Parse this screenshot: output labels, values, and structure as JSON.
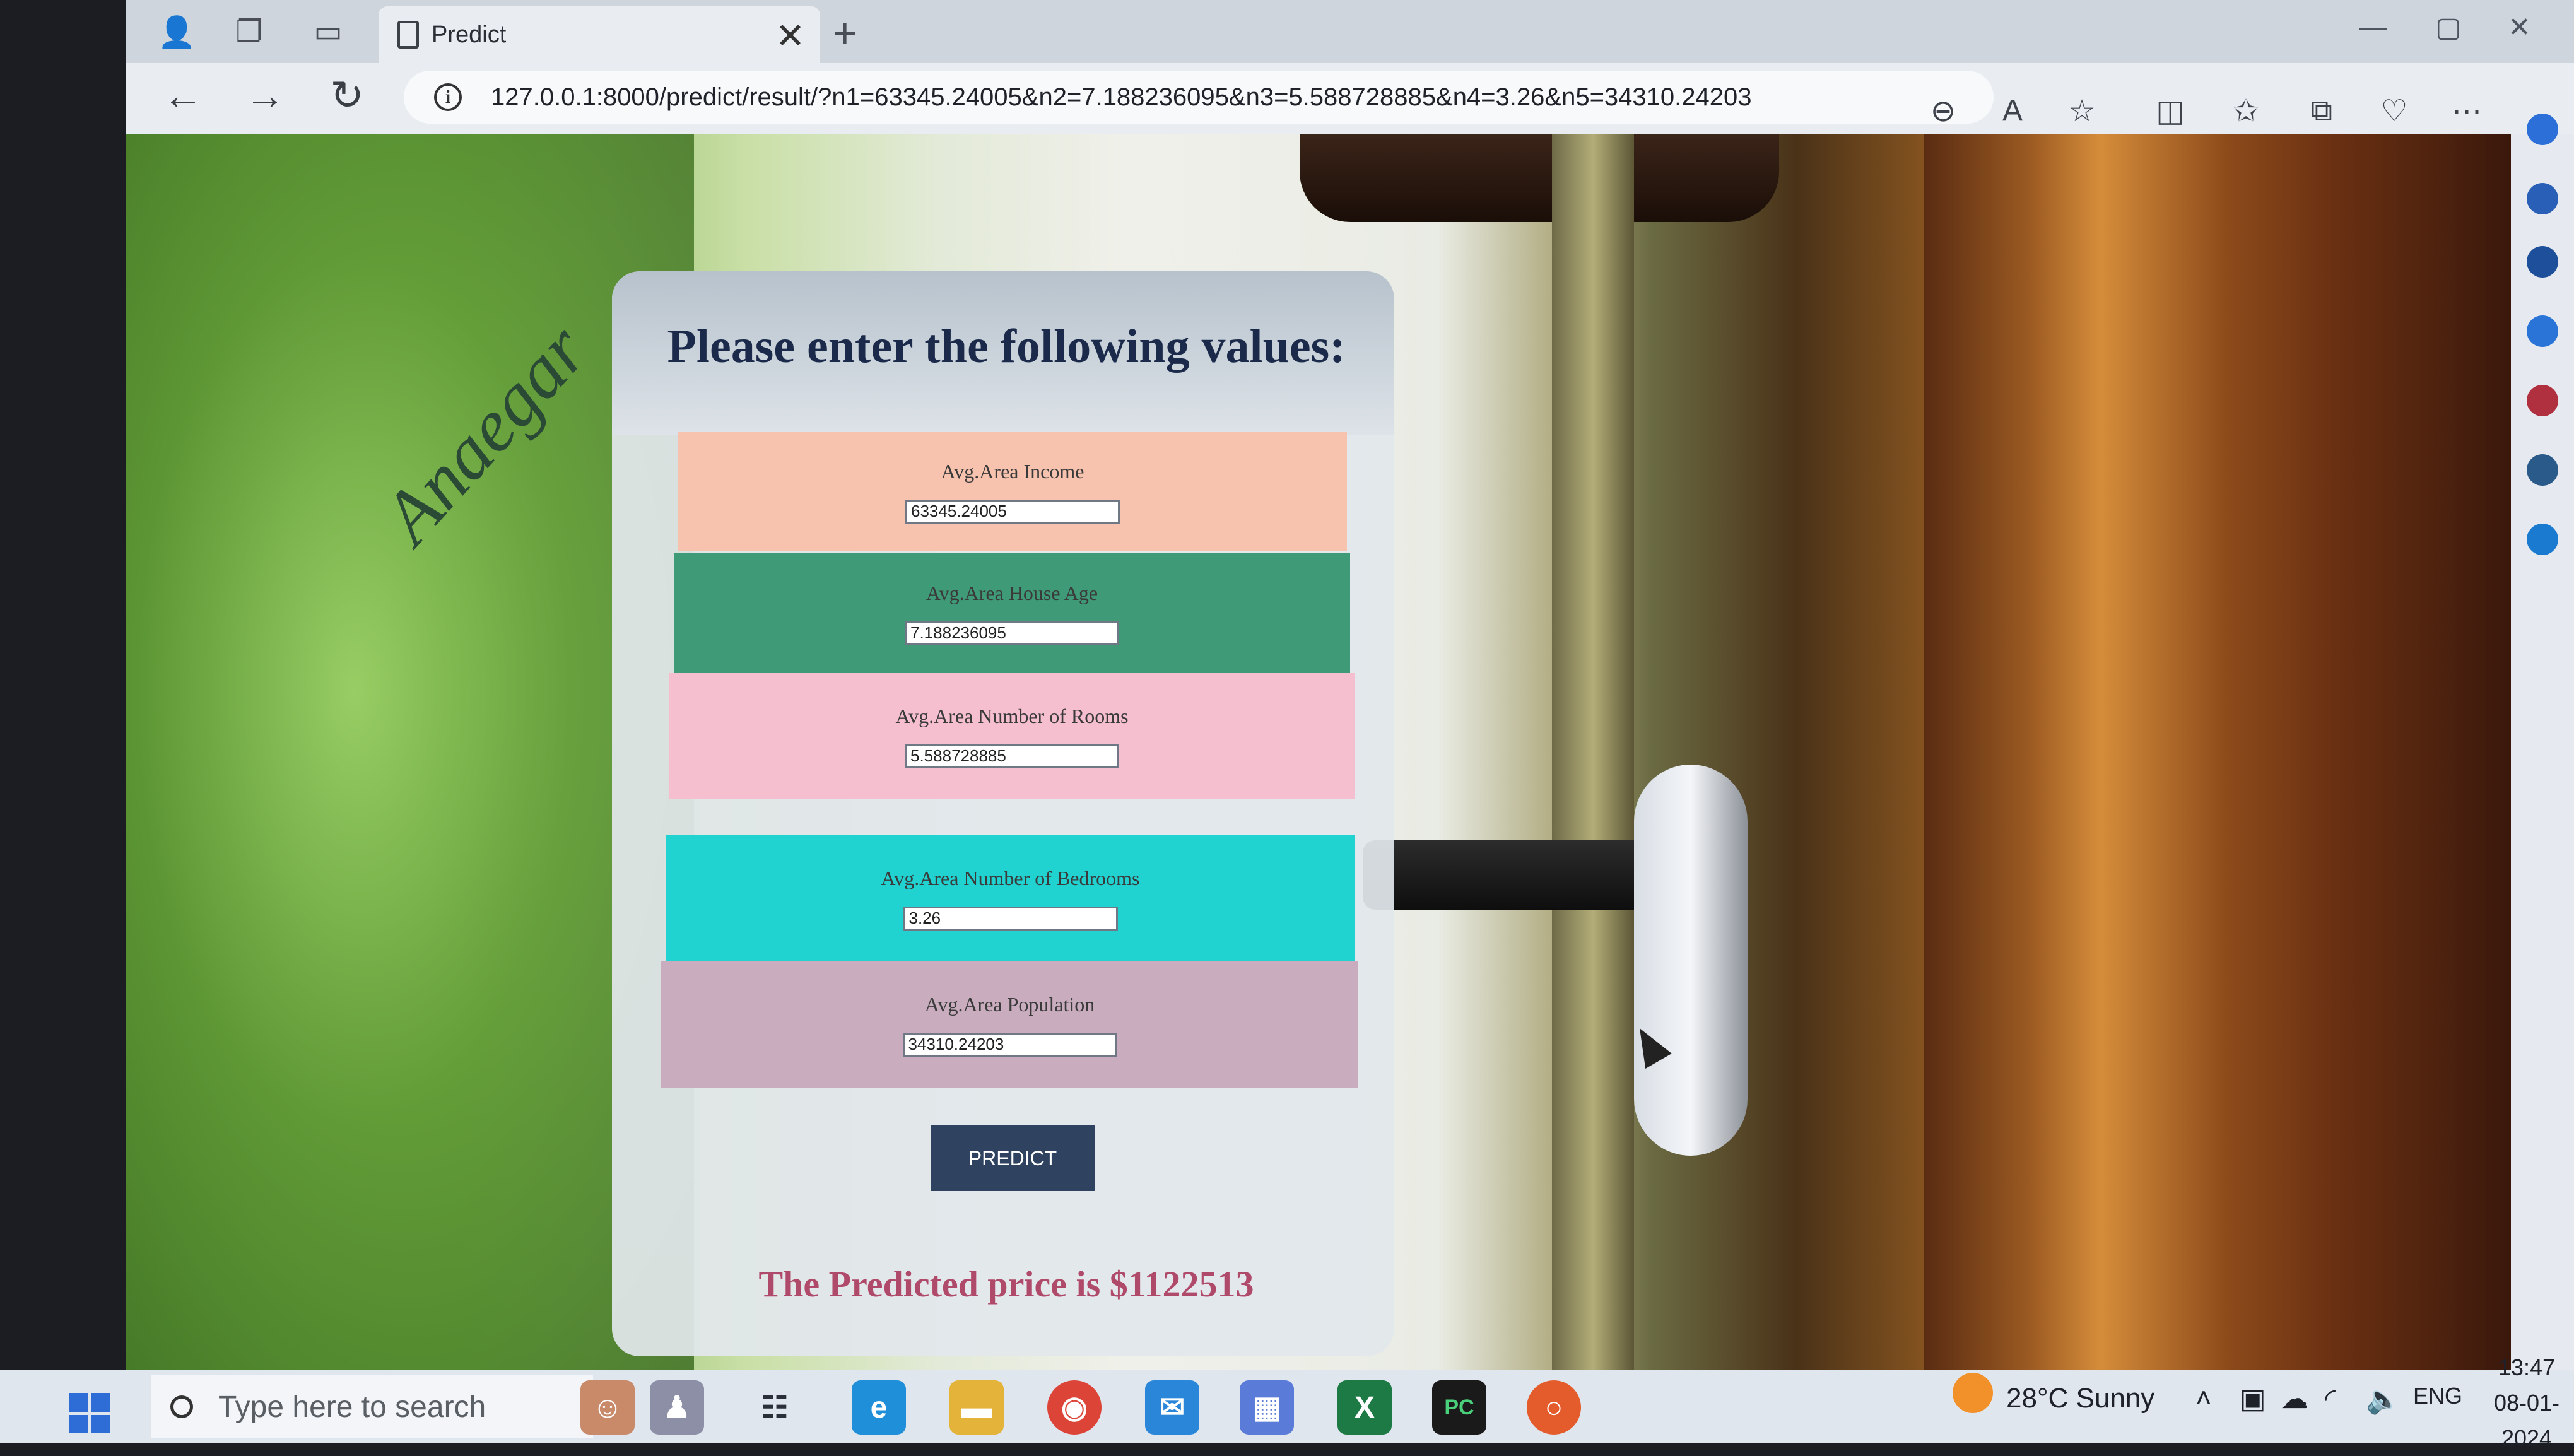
{
  "browser": {
    "tab_title": "Predict",
    "tab_close": "✕",
    "new_tab": "+",
    "url": "127.0.0.1:8000/predict/result/?n1=63345.24005&n2=7.188236095&n3=5.588728885&n4=3.26&n5=34310.24203",
    "toolbar_icons": [
      "zoom-out-icon",
      "read-aloud-icon",
      "favorite-icon",
      "split-screen-icon",
      "favorites-icon",
      "collections-icon",
      "browser-essentials-icon",
      "more-icon",
      "copilot-icon"
    ]
  },
  "form": {
    "title": "Please enter the following values:",
    "signature_text": "Anaegar",
    "fields": [
      {
        "label": "Avg.Area Income",
        "value": "63345.24005",
        "color": "#f7c3ae"
      },
      {
        "label": "Avg.Area House Age",
        "value": "7.188236095",
        "color": "#3f9a78"
      },
      {
        "label": "Avg.Area Number of Rooms",
        "value": "5.588728885",
        "color": "#f6bfcf"
      },
      {
        "label": "Avg.Area Number of Bedrooms",
        "value": "3.26",
        "color": "#20d2d0"
      },
      {
        "label": "Avg.Area Population",
        "value": "34310.24203",
        "color": "#c9adbf"
      }
    ],
    "button_label": "PREDICT",
    "result_text": "The Predicted price is $1122513"
  },
  "taskbar": {
    "search_placeholder": "Type here to search",
    "weather": "28°C  Sunny",
    "language": "ENG",
    "time": "13:47",
    "date": "08-01-2024"
  }
}
